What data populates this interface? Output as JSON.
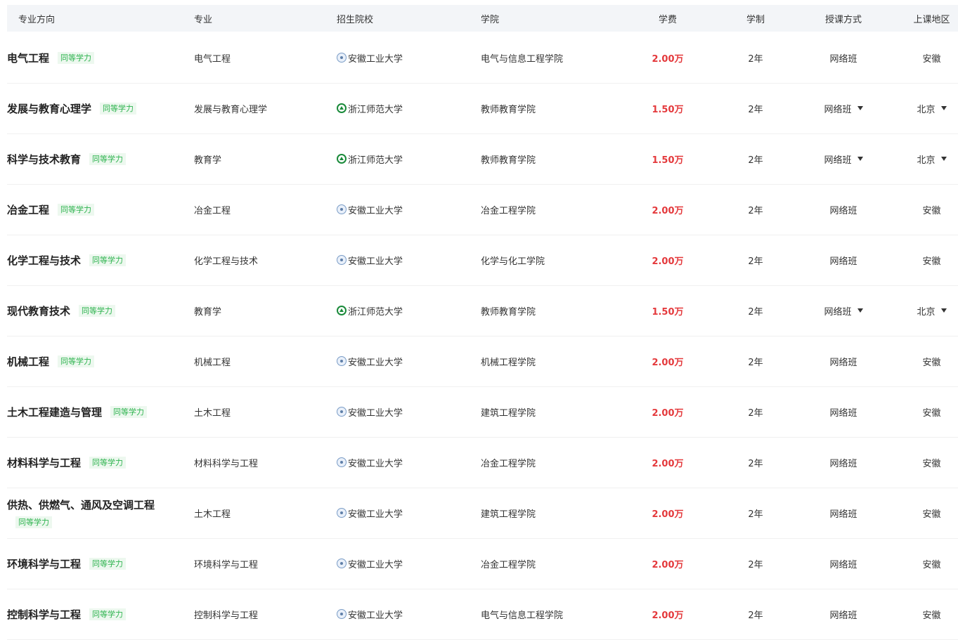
{
  "headers": {
    "direction": "专业方向",
    "major": "专业",
    "school": "招生院校",
    "college": "学院",
    "fee": "学费",
    "years": "学制",
    "mode": "授课方式",
    "region": "上课地区"
  },
  "rows": [
    {
      "direction": "电气工程",
      "tag": "同等学力",
      "major": "电气工程",
      "school": "安徽工业大学",
      "logo": "ahut-logo-icon",
      "college": "电气与信息工程学院",
      "fee": "2.00万",
      "years": "2年",
      "mode": "网络班",
      "region": "安徽",
      "dropdown": false
    },
    {
      "direction": "发展与教育心理学",
      "tag": "同等学力",
      "major": "发展与教育心理学",
      "school": "浙江师范大学",
      "logo": "zjnu-logo-icon",
      "college": "教师教育学院",
      "fee": "1.50万",
      "years": "2年",
      "mode": "网络班",
      "region": "北京",
      "dropdown": true
    },
    {
      "direction": "科学与技术教育",
      "tag": "同等学力",
      "major": "教育学",
      "school": "浙江师范大学",
      "logo": "zjnu-logo-icon",
      "college": "教师教育学院",
      "fee": "1.50万",
      "years": "2年",
      "mode": "网络班",
      "region": "北京",
      "dropdown": true
    },
    {
      "direction": "冶金工程",
      "tag": "同等学力",
      "major": "冶金工程",
      "school": "安徽工业大学",
      "logo": "ahut-logo-icon",
      "college": "冶金工程学院",
      "fee": "2.00万",
      "years": "2年",
      "mode": "网络班",
      "region": "安徽",
      "dropdown": false
    },
    {
      "direction": "化学工程与技术",
      "tag": "同等学力",
      "major": "化学工程与技术",
      "school": "安徽工业大学",
      "logo": "ahut-logo-icon",
      "college": "化学与化工学院",
      "fee": "2.00万",
      "years": "2年",
      "mode": "网络班",
      "region": "安徽",
      "dropdown": false
    },
    {
      "direction": "现代教育技术",
      "tag": "同等学力",
      "major": "教育学",
      "school": "浙江师范大学",
      "logo": "zjnu-logo-icon",
      "college": "教师教育学院",
      "fee": "1.50万",
      "years": "2年",
      "mode": "网络班",
      "region": "北京",
      "dropdown": true
    },
    {
      "direction": "机械工程",
      "tag": "同等学力",
      "major": "机械工程",
      "school": "安徽工业大学",
      "logo": "ahut-logo-icon",
      "college": "机械工程学院",
      "fee": "2.00万",
      "years": "2年",
      "mode": "网络班",
      "region": "安徽",
      "dropdown": false
    },
    {
      "direction": "土木工程建造与管理",
      "tag": "同等学力",
      "major": "土木工程",
      "school": "安徽工业大学",
      "logo": "ahut-logo-icon",
      "college": "建筑工程学院",
      "fee": "2.00万",
      "years": "2年",
      "mode": "网络班",
      "region": "安徽",
      "dropdown": false
    },
    {
      "direction": "材料科学与工程",
      "tag": "同等学力",
      "major": "材料科学与工程",
      "school": "安徽工业大学",
      "logo": "ahut-logo-icon",
      "college": "冶金工程学院",
      "fee": "2.00万",
      "years": "2年",
      "mode": "网络班",
      "region": "安徽",
      "dropdown": false
    },
    {
      "direction": "供热、供燃气、通风及空调工程",
      "tag": "同等学力",
      "major": "土木工程",
      "school": "安徽工业大学",
      "logo": "ahut-logo-icon",
      "college": "建筑工程学院",
      "fee": "2.00万",
      "years": "2年",
      "mode": "网络班",
      "region": "安徽",
      "dropdown": false
    },
    {
      "direction": "环境科学与工程",
      "tag": "同等学力",
      "major": "环境科学与工程",
      "school": "安徽工业大学",
      "logo": "ahut-logo-icon",
      "college": "冶金工程学院",
      "fee": "2.00万",
      "years": "2年",
      "mode": "网络班",
      "region": "安徽",
      "dropdown": false
    },
    {
      "direction": "控制科学与工程",
      "tag": "同等学力",
      "major": "控制科学与工程",
      "school": "安徽工业大学",
      "logo": "ahut-logo-icon",
      "college": "电气与信息工程学院",
      "fee": "2.00万",
      "years": "2年",
      "mode": "网络班",
      "region": "安徽",
      "dropdown": false
    }
  ]
}
